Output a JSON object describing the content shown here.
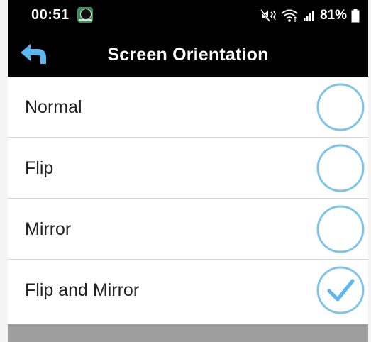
{
  "status_bar": {
    "time": "00:51",
    "battery_percent": "81%",
    "icons": [
      "app-notification-icon",
      "mute-vibrate-icon",
      "wifi-icon",
      "signal-icon",
      "battery-icon"
    ]
  },
  "header": {
    "title": "Screen Orientation",
    "back_icon": "back-arrow-icon"
  },
  "options": [
    {
      "label": "Normal",
      "selected": false
    },
    {
      "label": "Flip",
      "selected": false
    },
    {
      "label": "Mirror",
      "selected": false
    },
    {
      "label": "Flip and Mirror",
      "selected": true
    }
  ],
  "colors": {
    "accent": "#7fc4ea",
    "bar_background": "#000000",
    "bottom_bar": "#9e9e9e"
  }
}
